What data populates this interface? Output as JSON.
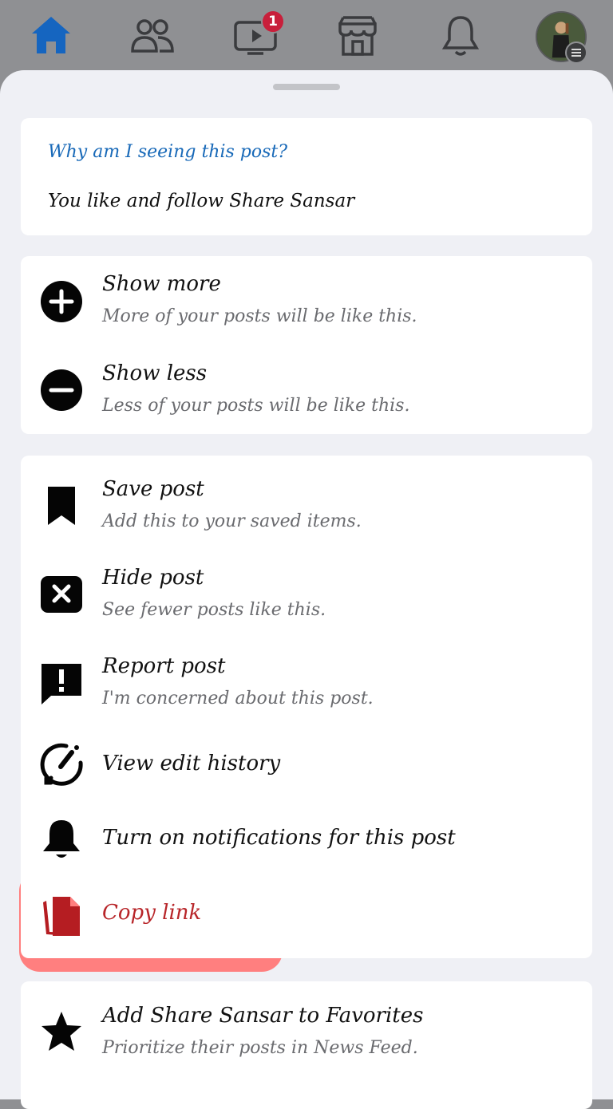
{
  "nav": {
    "items": [
      {
        "icon": "home-icon"
      },
      {
        "icon": "friends-icon"
      },
      {
        "icon": "watch-icon"
      },
      {
        "icon": "marketplace-icon"
      },
      {
        "icon": "bell-icon"
      },
      {
        "icon": "profile-avatar"
      }
    ],
    "watch_badge": "1",
    "colors": {
      "active": "#1565c0",
      "inactive": "#3a3b3e",
      "badge": "#c81f3b"
    }
  },
  "why": {
    "title": "Why am I seeing this post?",
    "reason": "You like and follow Share Sansar"
  },
  "feed_prefs": [
    {
      "icon": "plus-circle-icon",
      "title": "Show more",
      "subtitle": "More of your posts will be like this."
    },
    {
      "icon": "minus-circle-icon",
      "title": "Show less",
      "subtitle": "Less of your posts will be like this."
    }
  ],
  "actions": [
    {
      "icon": "bookmark-icon",
      "title": "Save post",
      "subtitle": "Add this to your saved items."
    },
    {
      "icon": "close-box-icon",
      "title": "Hide post",
      "subtitle": "See fewer posts like this."
    },
    {
      "icon": "report-icon",
      "title": "Report post",
      "subtitle": "I'm concerned about this post."
    },
    {
      "icon": "edit-history-icon",
      "title": "View edit history"
    },
    {
      "icon": "bell-icon",
      "title": "Turn on notifications for this post"
    },
    {
      "icon": "copy-icon",
      "title": "Copy link",
      "highlighted": true
    }
  ],
  "favorites": {
    "icon": "star-icon",
    "title": "Add Share Sansar to Favorites",
    "subtitle": "Prioritize their posts in News Feed."
  }
}
